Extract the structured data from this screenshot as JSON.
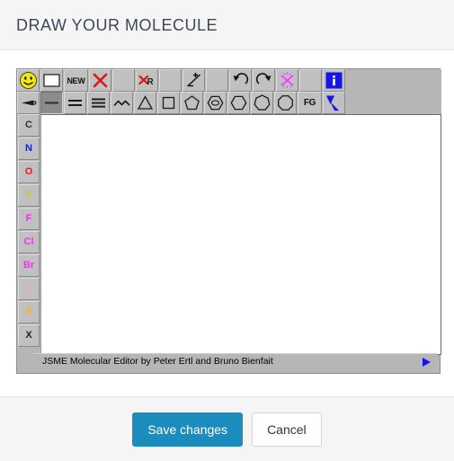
{
  "header": {
    "title": "DRAW YOUR MOLECULE"
  },
  "editor": {
    "status_text": "JSME Molecular Editor by Peter Ertl and Bruno Bienfait",
    "status_arrow_icon": "play-arrow-icon",
    "canvas_placeholder": "",
    "toolbar_row1": [
      {
        "name": "smiley-button",
        "icon": "smiley-icon",
        "label": "",
        "selected": false
      },
      {
        "name": "new-window-button",
        "icon": "white-rect-icon",
        "label": "",
        "selected": false
      },
      {
        "name": "new-button",
        "icon": "new-text-icon",
        "label": "NEW",
        "selected": false
      },
      {
        "name": "delete-button",
        "icon": "red-x-icon",
        "label": "",
        "selected": false
      },
      {
        "name": "spacer-1",
        "icon": "blank-icon",
        "label": "",
        "selected": false
      },
      {
        "name": "delete-group-button",
        "icon": "red-x-r-icon",
        "label": "",
        "selected": false
      },
      {
        "name": "spacer-2",
        "icon": "blank-icon",
        "label": "",
        "selected": false
      },
      {
        "name": "charge-button",
        "icon": "plus-minus-icon",
        "label": "",
        "selected": false
      },
      {
        "name": "spacer-3",
        "icon": "blank-icon",
        "label": "",
        "selected": false
      },
      {
        "name": "undo-button",
        "icon": "undo-arrow-icon",
        "label": "",
        "selected": false
      },
      {
        "name": "redo-button",
        "icon": "redo-arrow-icon",
        "label": "",
        "selected": false
      },
      {
        "name": "clean-button",
        "icon": "magenta-star-icon",
        "label": "",
        "selected": false
      },
      {
        "name": "spacer-4",
        "icon": "blank-icon",
        "label": "",
        "selected": false
      },
      {
        "name": "info-button",
        "icon": "info-icon",
        "label": "",
        "selected": false
      }
    ],
    "toolbar_row2": [
      {
        "name": "stereo-bond-button",
        "icon": "wedge-bond-icon",
        "label": "",
        "selected": false
      },
      {
        "name": "single-bond-button",
        "icon": "single-bond-icon",
        "label": "",
        "selected": true
      },
      {
        "name": "double-bond-button",
        "icon": "double-bond-icon",
        "label": "",
        "selected": false
      },
      {
        "name": "triple-bond-button",
        "icon": "triple-bond-icon",
        "label": "",
        "selected": false
      },
      {
        "name": "chain-button",
        "icon": "zigzag-chain-icon",
        "label": "",
        "selected": false
      },
      {
        "name": "ring3-button",
        "icon": "triangle-ring-icon",
        "label": "",
        "selected": false
      },
      {
        "name": "ring4-button",
        "icon": "square-ring-icon",
        "label": "",
        "selected": false
      },
      {
        "name": "ring5-button",
        "icon": "pentagon-ring-icon",
        "label": "",
        "selected": false
      },
      {
        "name": "benzene-button",
        "icon": "benzene-ring-icon",
        "label": "",
        "selected": false
      },
      {
        "name": "ring6-button",
        "icon": "hexagon-ring-icon",
        "label": "",
        "selected": false
      },
      {
        "name": "ring7-button",
        "icon": "heptagon-ring-icon",
        "label": "",
        "selected": false
      },
      {
        "name": "ring8-button",
        "icon": "octagon-ring-icon",
        "label": "",
        "selected": false
      },
      {
        "name": "functional-group-button",
        "icon": "fg-text-icon",
        "label": "FG",
        "selected": false
      },
      {
        "name": "template-button",
        "icon": "blue-triangles-icon",
        "label": "",
        "selected": false
      }
    ],
    "atoms": [
      {
        "symbol": "C",
        "color": "#333333"
      },
      {
        "symbol": "N",
        "color": "#1414ff"
      },
      {
        "symbol": "O",
        "color": "#ff1414"
      },
      {
        "symbol": "S",
        "color": "#c8c832"
      },
      {
        "symbol": "F",
        "color": "#ff28ff"
      },
      {
        "symbol": "Cl",
        "color": "#ff28ff"
      },
      {
        "symbol": "Br",
        "color": "#ff28ff"
      },
      {
        "symbol": "I",
        "color": "#ff9ad4"
      },
      {
        "symbol": "P",
        "color": "#ffaa28"
      },
      {
        "symbol": "X",
        "color": "#222222"
      }
    ]
  },
  "footer": {
    "save_label": "Save changes",
    "cancel_label": "Cancel",
    "primary_color": "#1b8cbe"
  }
}
